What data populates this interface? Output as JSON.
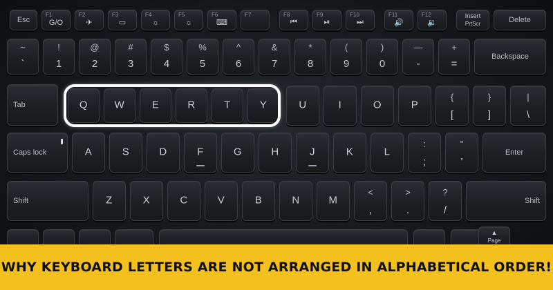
{
  "headline": "Why Keyboard Letters Are Not Arranged In Alphabetical Order!",
  "keyboard": {
    "row_function": [
      {
        "label": "Esc"
      },
      {
        "fn": "F1",
        "icon": "G/O"
      },
      {
        "fn": "F2",
        "icon": "✈"
      },
      {
        "fn": "F3",
        "icon": "▭"
      },
      {
        "fn": "F4",
        "icon": "☼"
      },
      {
        "fn": "F5",
        "icon": "☼"
      },
      {
        "fn": "F6",
        "icon": "⌨"
      },
      {
        "fn": "F7",
        "icon": ""
      },
      {
        "fn": "F8",
        "icon": "⏮"
      },
      {
        "fn": "F9",
        "icon": "⏯"
      },
      {
        "fn": "F10",
        "icon": "⏭"
      },
      {
        "fn": "F11",
        "icon": "🔊"
      },
      {
        "fn": "F12",
        "icon": "🔉"
      },
      {
        "top": "Insert",
        "bottom": "PrtScr"
      },
      {
        "label": "Delete"
      }
    ],
    "row_number": [
      {
        "top": "~",
        "bottom": "`"
      },
      {
        "top": "!",
        "bottom": "1"
      },
      {
        "top": "@",
        "bottom": "2"
      },
      {
        "top": "#",
        "bottom": "3"
      },
      {
        "top": "$",
        "bottom": "4"
      },
      {
        "top": "%",
        "bottom": "5"
      },
      {
        "top": "^",
        "bottom": "6"
      },
      {
        "top": "&",
        "bottom": "7"
      },
      {
        "top": "*",
        "bottom": "8"
      },
      {
        "top": "(",
        "bottom": "9"
      },
      {
        "top": ")",
        "bottom": "0"
      },
      {
        "top": "—",
        "bottom": "-"
      },
      {
        "top": "+",
        "bottom": "="
      },
      {
        "label": "Backspace"
      }
    ],
    "row_top": [
      {
        "label": "Tab"
      },
      {
        "label": "Q"
      },
      {
        "label": "W"
      },
      {
        "label": "E"
      },
      {
        "label": "R"
      },
      {
        "label": "T"
      },
      {
        "label": "Y"
      },
      {
        "label": "U"
      },
      {
        "label": "I"
      },
      {
        "label": "O"
      },
      {
        "label": "P"
      },
      {
        "top": "{",
        "bottom": "["
      },
      {
        "top": "}",
        "bottom": "]"
      },
      {
        "top": "|",
        "bottom": "\\"
      }
    ],
    "row_home": [
      {
        "label": "Caps lock"
      },
      {
        "label": "A"
      },
      {
        "label": "S"
      },
      {
        "label": "D"
      },
      {
        "label": "F"
      },
      {
        "label": "G"
      },
      {
        "label": "H"
      },
      {
        "label": "J"
      },
      {
        "label": "K"
      },
      {
        "label": "L"
      },
      {
        "top": ":",
        "bottom": ";"
      },
      {
        "top": "\"",
        "bottom": "'"
      },
      {
        "label": "Enter"
      }
    ],
    "row_bottom": [
      {
        "label": "Shift"
      },
      {
        "label": "Z"
      },
      {
        "label": "X"
      },
      {
        "label": "C"
      },
      {
        "label": "V"
      },
      {
        "label": "B"
      },
      {
        "label": "N"
      },
      {
        "label": "M"
      },
      {
        "top": "<",
        "bottom": ","
      },
      {
        "top": ">",
        "bottom": "."
      },
      {
        "top": "?",
        "bottom": "/"
      },
      {
        "label": "Shift"
      }
    ],
    "pgup": {
      "label": "Page"
    }
  }
}
